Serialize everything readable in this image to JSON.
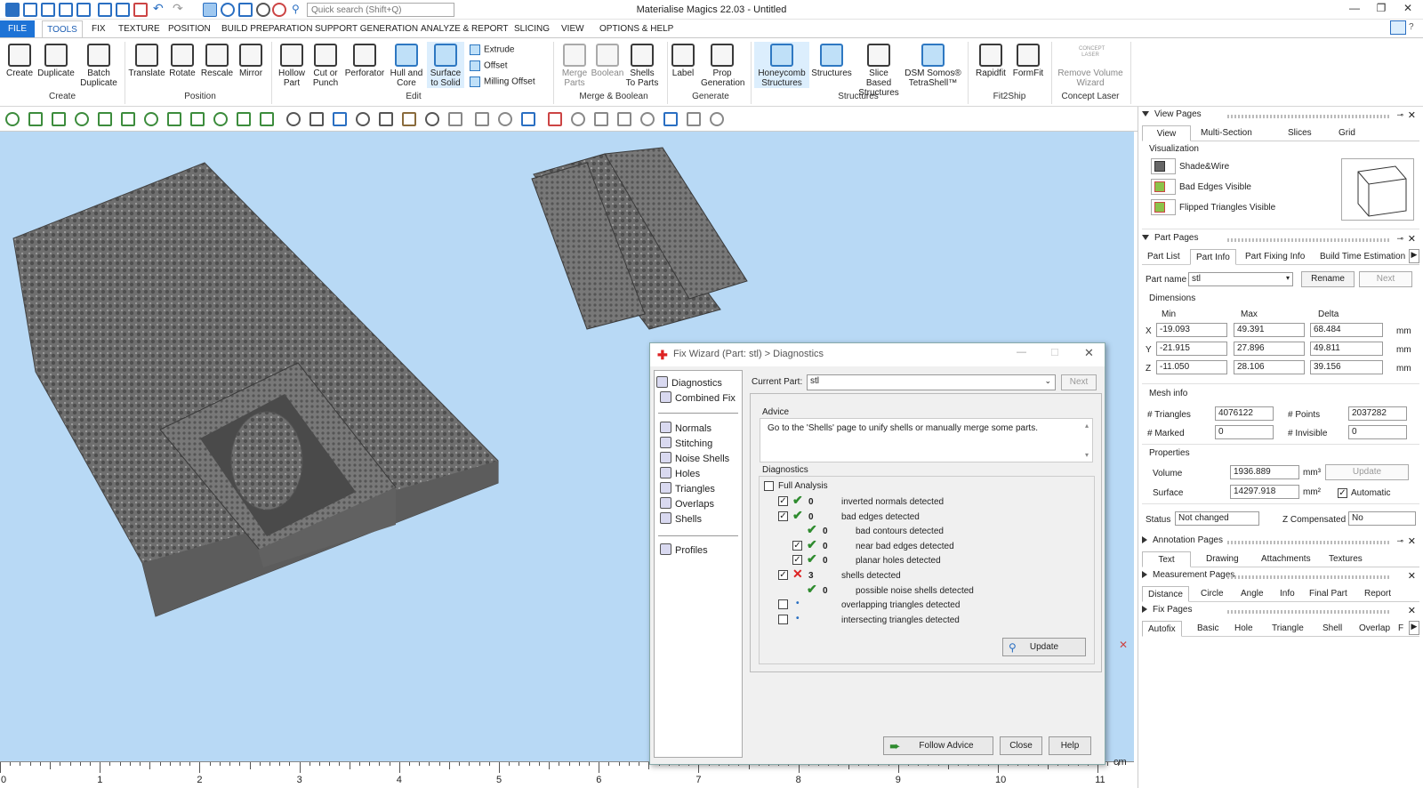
{
  "window": {
    "title": "Materialise Magics 22.03 - Untitled",
    "min": "—",
    "restore": "❐",
    "close": "✕"
  },
  "search": {
    "placeholder": "Quick search (Shift+Q)"
  },
  "menu": {
    "file": "FILE",
    "tools": "TOOLS",
    "items": [
      "FIX",
      "TEXTURE",
      "POSITION",
      "BUILD PREPARATION",
      "SUPPORT GENERATION",
      "ANALYZE & REPORT",
      "SLICING",
      "VIEW",
      "OPTIONS & HELP"
    ]
  },
  "ribbon": {
    "create": [
      "Create",
      "Duplicate",
      "Batch Duplicate"
    ],
    "position": [
      "Translate",
      "Rotate",
      "Rescale",
      "Mirror"
    ],
    "edit": [
      "Hollow Part",
      "Cut or Punch",
      "Perforator",
      "Hull and Core",
      "Surface to Solid"
    ],
    "edit_small": [
      "Extrude",
      "Offset",
      "Milling Offset"
    ],
    "merge": [
      "Merge Parts",
      "Boolean",
      "Shells To Parts"
    ],
    "generate": [
      "Label",
      "Prop Generation"
    ],
    "structures": [
      "Honeycomb Structures",
      "Structures",
      "Slice Based Structures",
      "DSM Somos® TetraShell™"
    ],
    "fit2ship": [
      "Rapidfit",
      "FormFit"
    ],
    "concept": [
      "Remove Volume Wizard"
    ],
    "concept_logo": "CONCEPT LASER",
    "groups": [
      "Create",
      "Position",
      "Edit",
      "Merge & Boolean",
      "Generate",
      "Structures",
      "Fit2Ship",
      "Concept Laser"
    ]
  },
  "ruler": {
    "labels": [
      "0",
      "1",
      "2",
      "3",
      "4",
      "5",
      "6",
      "7",
      "8",
      "9",
      "10",
      "11"
    ],
    "unit": "cm"
  },
  "view_pages": {
    "title": "View Pages",
    "tabs": [
      "View",
      "Multi-Section",
      "Slices",
      "Grid"
    ],
    "section": "Visualization",
    "items": [
      "Shade&Wire",
      "Bad Edges Visible",
      "Flipped Triangles Visible"
    ]
  },
  "part_pages": {
    "title": "Part Pages",
    "tabs": [
      "Part List",
      "Part Info",
      "Part Fixing Info",
      "Build Time Estimation"
    ],
    "part_name_label": "Part name",
    "part_name": "stl",
    "rename": "Rename",
    "next": "Next",
    "dimensions": "Dimensions",
    "cols": [
      "Min",
      "Max",
      "Delta"
    ],
    "rows": [
      {
        "axis": "X",
        "min": "-19.093",
        "max": "49.391",
        "delta": "68.484",
        "unit": "mm"
      },
      {
        "axis": "Y",
        "min": "-21.915",
        "max": "27.896",
        "delta": "49.811",
        "unit": "mm"
      },
      {
        "axis": "Z",
        "min": "-11.050",
        "max": "28.106",
        "delta": "39.156",
        "unit": "mm"
      }
    ],
    "mesh_info": "Mesh info",
    "triangles_label": "# Triangles",
    "triangles": "4076122",
    "points_label": "# Points",
    "points": "2037282",
    "marked_label": "# Marked",
    "marked": "0",
    "invisible_label": "# Invisible",
    "invisible": "0",
    "properties": "Properties",
    "volume_label": "Volume",
    "volume": "1936.889",
    "volume_unit": "mm³",
    "update": "Update",
    "surface_label": "Surface",
    "surface": "14297.918",
    "surface_unit": "mm²",
    "automatic": "Automatic",
    "status_label": "Status",
    "status": "Not changed",
    "zcomp_label": "Z Compensated",
    "zcomp": "No"
  },
  "annotation_pages": {
    "title": "Annotation Pages",
    "tabs": [
      "Text",
      "Drawing",
      "Attachments",
      "Textures"
    ]
  },
  "measurement_pages": {
    "title": "Measurement Pages",
    "tabs": [
      "Distance",
      "Circle",
      "Angle",
      "Info",
      "Final Part",
      "Report"
    ]
  },
  "fix_pages": {
    "title": "Fix Pages",
    "tabs": [
      "Autofix",
      "Basic",
      "Hole",
      "Triangle",
      "Shell",
      "Overlap",
      "F"
    ]
  },
  "fix_wizard": {
    "title": "Fix Wizard (Part: stl) > Diagnostics",
    "nav": [
      "Diagnostics",
      "Combined Fix",
      "Normals",
      "Stitching",
      "Noise Shells",
      "Holes",
      "Triangles",
      "Overlaps",
      "Shells",
      "Profiles"
    ],
    "current_part_label": "Current Part:",
    "current_part": "stl",
    "next": "Next",
    "advice_title": "Advice",
    "advice": "Go to the 'Shells' page to unify shells or manually merge some parts.",
    "diagnostics_title": "Diagnostics",
    "full_analysis": "Full Analysis",
    "rows": [
      {
        "checked": true,
        "status": "ok",
        "count": "0",
        "label": "inverted normals detected",
        "indent": 0
      },
      {
        "checked": true,
        "status": "ok",
        "count": "0",
        "label": "bad edges detected",
        "indent": 0
      },
      {
        "checked": null,
        "status": "ok",
        "count": "0",
        "label": "bad contours detected",
        "indent": 1
      },
      {
        "checked": true,
        "status": "ok",
        "count": "0",
        "label": "near bad edges detected",
        "indent": 1
      },
      {
        "checked": true,
        "status": "ok",
        "count": "0",
        "label": "planar holes detected",
        "indent": 1
      },
      {
        "checked": true,
        "status": "bad",
        "count": "3",
        "label": "shells detected",
        "indent": 0
      },
      {
        "checked": null,
        "status": "ok",
        "count": "0",
        "label": "possible noise shells detected",
        "indent": 1
      },
      {
        "checked": false,
        "status": "dot",
        "count": "",
        "label": "overlapping triangles detected",
        "indent": 0
      },
      {
        "checked": false,
        "status": "dot",
        "count": "",
        "label": "intersecting triangles detected",
        "indent": 0
      }
    ],
    "update": "Update",
    "follow_advice": "Follow Advice",
    "close": "Close",
    "help": "Help"
  },
  "colors": {
    "accent": "#1e73d6",
    "viewport": "#b8d9f5",
    "model": "#6f6f6f",
    "ok": "#2e8b2e",
    "bad": "#dd2222"
  }
}
